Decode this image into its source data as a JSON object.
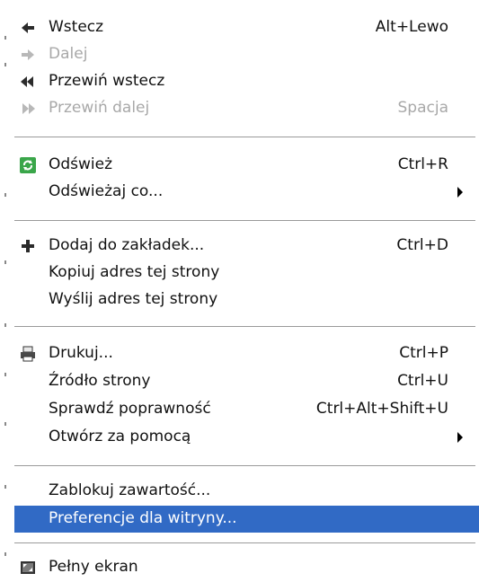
{
  "menu": {
    "items": [
      {
        "label": "Wstecz",
        "shortcut": "Alt+Lewo",
        "icon": "back-arrow-icon",
        "enabled": true
      },
      {
        "label": "Dalej",
        "shortcut": "",
        "icon": "forward-arrow-icon",
        "enabled": false
      },
      {
        "label": "Przewiń wstecz",
        "shortcut": "",
        "icon": "rewind-icon",
        "enabled": true
      },
      {
        "label": "Przewiń dalej",
        "shortcut": "Spacja",
        "icon": "fast-forward-icon",
        "enabled": false
      },
      {
        "label": "Odśwież",
        "shortcut": "Ctrl+R",
        "icon": "refresh-icon",
        "enabled": true
      },
      {
        "label": "Odświeżaj co...",
        "shortcut": "",
        "submenu": true,
        "enabled": true
      },
      {
        "label": "Dodaj do zakładek...",
        "shortcut": "Ctrl+D",
        "icon": "add-bookmark-icon",
        "enabled": true
      },
      {
        "label": "Kopiuj adres tej strony",
        "shortcut": "",
        "enabled": true
      },
      {
        "label": "Wyślij adres tej strony",
        "shortcut": "",
        "enabled": true
      },
      {
        "label": "Drukuj...",
        "shortcut": "Ctrl+P",
        "icon": "printer-icon",
        "enabled": true
      },
      {
        "label": "Źródło strony",
        "shortcut": "Ctrl+U",
        "enabled": true
      },
      {
        "label": "Sprawdź poprawność",
        "shortcut": "Ctrl+Alt+Shift+U",
        "enabled": true
      },
      {
        "label": "Otwórz za pomocą",
        "shortcut": "",
        "submenu": true,
        "enabled": true
      },
      {
        "label": "Zablokuj zawartość...",
        "shortcut": "",
        "enabled": true
      },
      {
        "label": "Preferencje dla witryny...",
        "shortcut": "",
        "enabled": true,
        "highlighted": true
      },
      {
        "label": "Pełny ekran",
        "shortcut": "",
        "icon": "fullscreen-icon",
        "enabled": true
      }
    ]
  },
  "colors": {
    "highlight": "#316ac5",
    "disabled": "#a8a8a8",
    "refresh_icon": "#3aa64a",
    "separator": "#9a9a9a"
  }
}
